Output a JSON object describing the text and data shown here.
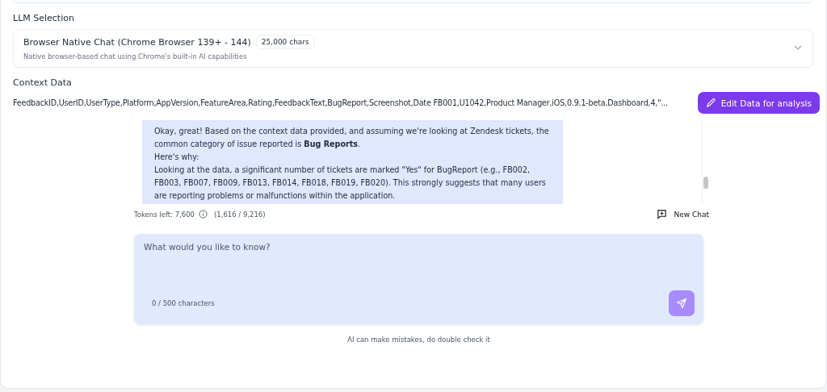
{
  "llm_selection": {
    "heading": "LLM Selection",
    "model": {
      "name": "Browser Native Chat (Chrome Browser 139+ - 144)",
      "badge": "25,000 chars",
      "description": "Native browser-based chat using Chrome's built-in AI capabilities"
    }
  },
  "context_data": {
    "heading": "Context Data",
    "preview": "FeedbackID,UserID,UserType,Platform,AppVersion,FeatureArea,Rating,FeedbackText,BugReport,Screenshot,Date FB001,U1042,Product Manager,iOS,0.9.1-beta,Dashboard,4,\"...",
    "edit_button": "Edit Data for analysis"
  },
  "chat": {
    "message": [
      "Okay, great! Based on the context data provided, and assuming we're looking at Zendesk tickets, the common category of issue reported is **Bug Reports**.",
      "Here's why:",
      "Looking at the data, a significant number of tickets are marked \"Yes\" for BugReport (e.g., FB002, FB003, FB007, FB009, FB013, FB014, FB018, FB019, FB020). This strongly suggests that many users are reporting problems or malfunctions within the application."
    ],
    "tokens_left": "Tokens left: 7,600",
    "token_usage": "(1,616 / 9,216)",
    "new_chat": "New Chat",
    "input": {
      "placeholder": "What would you like to know?",
      "counter": "0 / 500 characters",
      "send_disabled": true
    },
    "disclaimer": "AI can make mistakes, do double check it"
  }
}
